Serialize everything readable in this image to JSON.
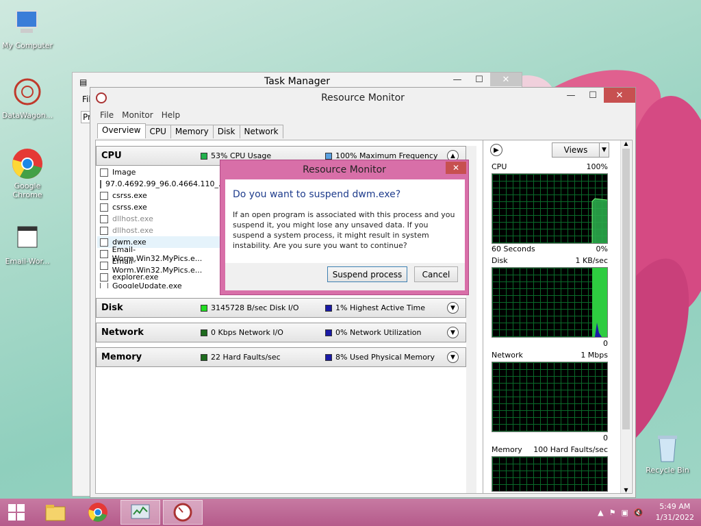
{
  "desktop": {
    "icons": [
      {
        "label": "My Computer"
      },
      {
        "label": "DataWagon..."
      },
      {
        "label": "Google Chrome"
      },
      {
        "label": "Email-Wor..."
      },
      {
        "label": "Recycle Bin"
      }
    ]
  },
  "task_manager": {
    "title": "Task Manager",
    "menu_peek": "Fil",
    "tab_peek": "Pr"
  },
  "resource_monitor": {
    "title": "Resource Monitor",
    "menu": [
      "File",
      "Monitor",
      "Help"
    ],
    "tabs": [
      "Overview",
      "CPU",
      "Memory",
      "Disk",
      "Network"
    ],
    "sections": {
      "cpu": {
        "name": "CPU",
        "metric1": "53% CPU Usage",
        "metric2": "100% Maximum Frequency",
        "color1": "#22b14c",
        "color2": "#5aa0e0"
      },
      "disk": {
        "name": "Disk",
        "metric1": "3145728 B/sec Disk I/O",
        "metric2": "1% Highest Active Time",
        "color1": "#22dd22",
        "color2": "#1a1aa6"
      },
      "network": {
        "name": "Network",
        "metric1": "0 Kbps Network I/O",
        "metric2": "0% Network Utilization",
        "color1": "#1e6b1e",
        "color2": "#1a1aa6"
      },
      "memory": {
        "name": "Memory",
        "metric1": "22 Hard Faults/sec",
        "metric2": "8% Used Physical Memory",
        "color1": "#1e6b1e",
        "color2": "#1a1aa6"
      }
    },
    "process_header": "Image",
    "processes": [
      {
        "name": "97.0.4692.99_96.0.4664.110_...",
        "dim": false
      },
      {
        "name": "csrss.exe",
        "dim": false
      },
      {
        "name": "csrss.exe",
        "dim": false
      },
      {
        "name": "dllhost.exe",
        "dim": true
      },
      {
        "name": "dllhost.exe",
        "dim": true
      },
      {
        "name": "dwm.exe",
        "dim": false
      },
      {
        "name": "Email-Worm.Win32.MyPics.e...",
        "dim": false
      },
      {
        "name": "Email-Worm.Win32.MyPics.e...",
        "dim": false
      },
      {
        "name": "explorer.exe",
        "dim": false
      },
      {
        "name": "GoogleUpdate.exe",
        "dim": false
      }
    ],
    "views_label": "Views",
    "graphs": {
      "cpu": {
        "label": "CPU",
        "top": "100%",
        "bottom_left": "60 Seconds",
        "bottom_right": "0%"
      },
      "disk": {
        "label": "Disk",
        "top": "1 KB/sec",
        "bottom_right": "0"
      },
      "network": {
        "label": "Network",
        "top": "1 Mbps",
        "bottom_right": "0"
      },
      "memory": {
        "label": "Memory",
        "top": "100 Hard Faults/sec"
      }
    }
  },
  "dialog": {
    "title": "Resource Monitor",
    "heading": "Do you want to suspend dwm.exe?",
    "body": "If an open program is associated with this process and you suspend it, you might lose any unsaved data. If you suspend a system process, it might result in system instability. Are you sure you want to continue?",
    "confirm_label": "Suspend process",
    "cancel_label": "Cancel"
  },
  "taskbar": {
    "time": "5:49 AM",
    "date": "1/31/2022"
  }
}
